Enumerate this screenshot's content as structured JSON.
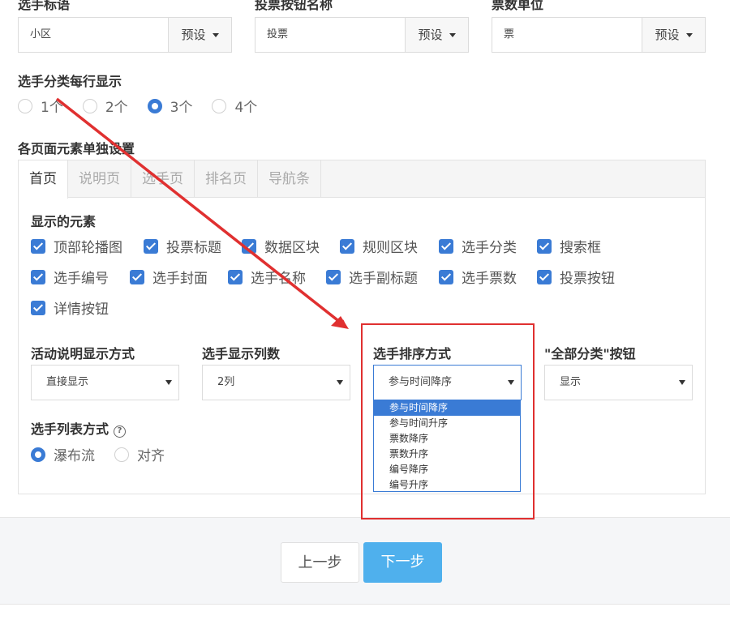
{
  "top_fields": [
    {
      "label": "选手标语",
      "value": "小区",
      "preset": "预设"
    },
    {
      "label": "投票按钮名称",
      "value": "投票",
      "preset": "预设"
    },
    {
      "label": "票数单位",
      "value": "票",
      "preset": "预设"
    }
  ],
  "per_row": {
    "label": "选手分类每行显示",
    "options": [
      "1个",
      "2个",
      "3个",
      "4个"
    ],
    "selected": "3个"
  },
  "element_settings": {
    "label": "各页面元素单独设置",
    "tabs": [
      "首页",
      "说明页",
      "选手页",
      "排名页",
      "导航条"
    ],
    "active_tab": "首页",
    "elements_label": "显示的元素",
    "elements": [
      "顶部轮播图",
      "投票标题",
      "数据区块",
      "规则区块",
      "选手分类",
      "搜索框",
      "选手编号",
      "选手封面",
      "选手名称",
      "选手副标题",
      "选手票数",
      "投票按钮",
      "详情按钮"
    ],
    "selects": [
      {
        "label": "活动说明显示方式",
        "value": "直接显示"
      },
      {
        "label": "选手显示列数",
        "value": "2列"
      },
      {
        "label": "选手排序方式",
        "value": "参与时间降序"
      },
      {
        "label": "\"全部分类\"按钮",
        "value": "显示"
      }
    ],
    "sort_options": [
      "参与时间降序",
      "参与时间升序",
      "票数降序",
      "票数升序",
      "编号降序",
      "编号升序"
    ],
    "sort_selected": "参与时间降序",
    "list_mode": {
      "label": "选手列表方式",
      "help_glyph": "?",
      "options": [
        "瀑布流",
        "对齐"
      ],
      "selected": "瀑布流"
    }
  },
  "footer": {
    "prev_label": "上一步",
    "next_label": "下一步"
  },
  "colors": {
    "accent": "#3a7bd5",
    "next_button": "#4fb0ed",
    "annotation": "#e03030"
  }
}
